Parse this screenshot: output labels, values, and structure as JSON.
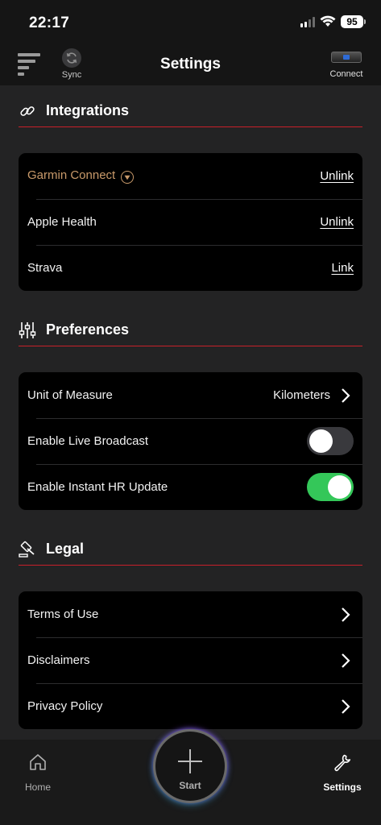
{
  "status_bar": {
    "time": "22:17",
    "battery": "95"
  },
  "header": {
    "title": "Settings",
    "sync_label": "Sync",
    "connect_label": "Connect"
  },
  "integrations": {
    "title": "Integrations",
    "rows": [
      {
        "label": "Garmin Connect",
        "action": "Unlink"
      },
      {
        "label": "Apple Health",
        "action": "Unlink"
      },
      {
        "label": "Strava",
        "action": "Link"
      }
    ]
  },
  "preferences": {
    "title": "Preferences",
    "unit": {
      "label": "Unit of Measure",
      "value": "Kilometers"
    },
    "live_broadcast": {
      "label": "Enable Live Broadcast",
      "enabled": false
    },
    "instant_hr": {
      "label": "Enable Instant HR Update",
      "enabled": true
    }
  },
  "legal": {
    "title": "Legal",
    "rows": [
      {
        "label": "Terms of Use"
      },
      {
        "label": "Disclaimers"
      },
      {
        "label": "Privacy Policy"
      }
    ]
  },
  "tabbar": {
    "home": "Home",
    "start": "Start",
    "settings": "Settings",
    "active": "Settings"
  },
  "colors": {
    "accent_red": "#c8202a",
    "garmin_text": "#c99a6a",
    "toggle_on": "#34c759",
    "card_bg": "#000000",
    "page_bg": "#232324"
  }
}
